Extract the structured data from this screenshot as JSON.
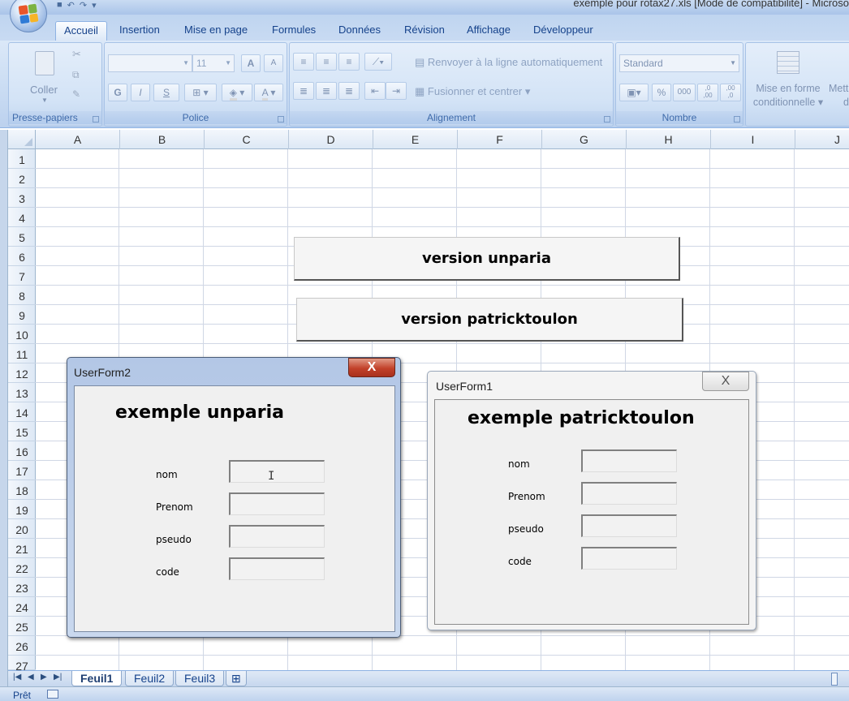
{
  "window": {
    "title": "exemple pour rotax27.xls  [Mode de compatibilité] - Microso"
  },
  "quick_access": {
    "save_icon": "save-icon",
    "undo_icon": "undo-icon",
    "redo_icon": "redo-icon"
  },
  "ribbon_tabs": [
    "Accueil",
    "Insertion",
    "Mise en page",
    "Formules",
    "Données",
    "Révision",
    "Affichage",
    "Développeur"
  ],
  "ribbon": {
    "clipboard": {
      "label": "Presse-papiers",
      "paste_label": "Coller"
    },
    "font": {
      "label": "Police",
      "font_name": "",
      "font_size": "11",
      "grow": "A",
      "shrink": "A",
      "bold": "G",
      "italic": "I",
      "underline": "S",
      "color_letter": "A"
    },
    "alignment": {
      "label": "Alignement",
      "wrap": "Renvoyer à la ligne automatiquement",
      "merge": "Fusionner et centrer"
    },
    "number": {
      "label": "Nombre",
      "format": "Standard",
      "percent": "%",
      "thousands": "000",
      "inc_decimal": ",0\n,00",
      "dec_decimal": ",00\n,0"
    },
    "styles": {
      "cond_format_line1": "Mise en forme",
      "cond_format_line2": "conditionnelle",
      "next_line1": "Mett",
      "next_line2": "d"
    }
  },
  "columns": [
    "A",
    "B",
    "C",
    "D",
    "E",
    "F",
    "G",
    "H",
    "I",
    "J"
  ],
  "rows": [
    "1",
    "2",
    "3",
    "4",
    "5",
    "6",
    "7",
    "8",
    "9",
    "10",
    "11",
    "12",
    "13",
    "14",
    "15",
    "16",
    "17",
    "18",
    "19",
    "20",
    "21",
    "22",
    "23",
    "24",
    "25",
    "26",
    "27"
  ],
  "sheet_buttons": {
    "unparia": "version unparia",
    "patricktoulon": "version patricktoulon"
  },
  "userform2": {
    "title": "UserForm2",
    "close": "X",
    "heading": "exemple unparia",
    "fields": [
      {
        "label": "nom",
        "value": ""
      },
      {
        "label": "Prenom",
        "value": ""
      },
      {
        "label": "pseudo",
        "value": ""
      },
      {
        "label": "code",
        "value": ""
      }
    ]
  },
  "userform1": {
    "title": "UserForm1",
    "close": "X",
    "heading": "exemple patricktoulon",
    "fields": [
      {
        "label": "nom",
        "value": ""
      },
      {
        "label": "Prenom",
        "value": ""
      },
      {
        "label": "pseudo",
        "value": ""
      },
      {
        "label": "code",
        "value": ""
      }
    ]
  },
  "sheet_tabs": [
    "Feuil1",
    "Feuil2",
    "Feuil3"
  ],
  "active_sheet": "Feuil1",
  "status": {
    "text": "Prêt"
  },
  "colors": {
    "ribbon_bg": "#c7daf2",
    "grid_line": "#d0d7e5",
    "close_red": "#c2412a",
    "accent_text": "#15428b"
  }
}
